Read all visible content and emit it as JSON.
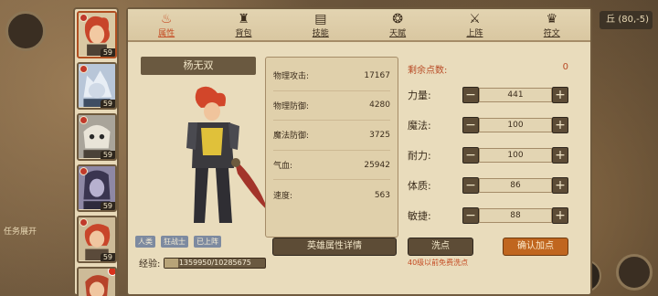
{
  "map": {
    "coords": "丘 (80,-5)",
    "task_expand": "任务展开"
  },
  "hero_list": [
    {
      "level": "59",
      "selected": true
    },
    {
      "level": "59",
      "selected": false
    },
    {
      "level": "59",
      "selected": false
    },
    {
      "level": "59",
      "selected": false
    },
    {
      "level": "59",
      "selected": false
    },
    {
      "level": "",
      "selected": false
    }
  ],
  "tabs": [
    {
      "label": "属性",
      "icon": "flame-icon",
      "active": true
    },
    {
      "label": "背包",
      "icon": "bag-icon",
      "active": false
    },
    {
      "label": "技能",
      "icon": "book-icon",
      "active": false
    },
    {
      "label": "天赋",
      "icon": "scroll-icon",
      "active": false
    },
    {
      "label": "上阵",
      "icon": "crossed-swords-icon",
      "active": false
    },
    {
      "label": "符文",
      "icon": "rune-icon",
      "active": false
    }
  ],
  "hero": {
    "name": "杨无双",
    "tags": [
      "人类",
      "狂战士",
      "已上阵"
    ],
    "exp_label": "经验:",
    "exp_text": "1359950/10285675",
    "exp_fraction": 0.132
  },
  "stats": [
    {
      "label": "物理攻击:",
      "value": "17167"
    },
    {
      "label": "物理防御:",
      "value": "4280"
    },
    {
      "label": "魔法防御:",
      "value": "3725"
    },
    {
      "label": "气血:",
      "value": "25942"
    },
    {
      "label": "速度:",
      "value": "563"
    }
  ],
  "detail_button": "英雄属性详情",
  "points": {
    "remaining_label": "剩余点数:",
    "remaining_value": "0",
    "attributes": [
      {
        "name": "力量:",
        "value": "441"
      },
      {
        "name": "魔法:",
        "value": "100"
      },
      {
        "name": "耐力:",
        "value": "100"
      },
      {
        "name": "体质:",
        "value": "86"
      },
      {
        "name": "敏捷:",
        "value": "88"
      }
    ],
    "minus": "−",
    "plus": "+",
    "wash_button": "洗点",
    "confirm_button": "确认加点",
    "free_wash_note": "40级以前免费洗点"
  },
  "colors": {
    "accent": "#c54c24",
    "panel": "#e9dcbc",
    "button_dark": "#5d4c36",
    "button_orange": "#c0661f"
  }
}
